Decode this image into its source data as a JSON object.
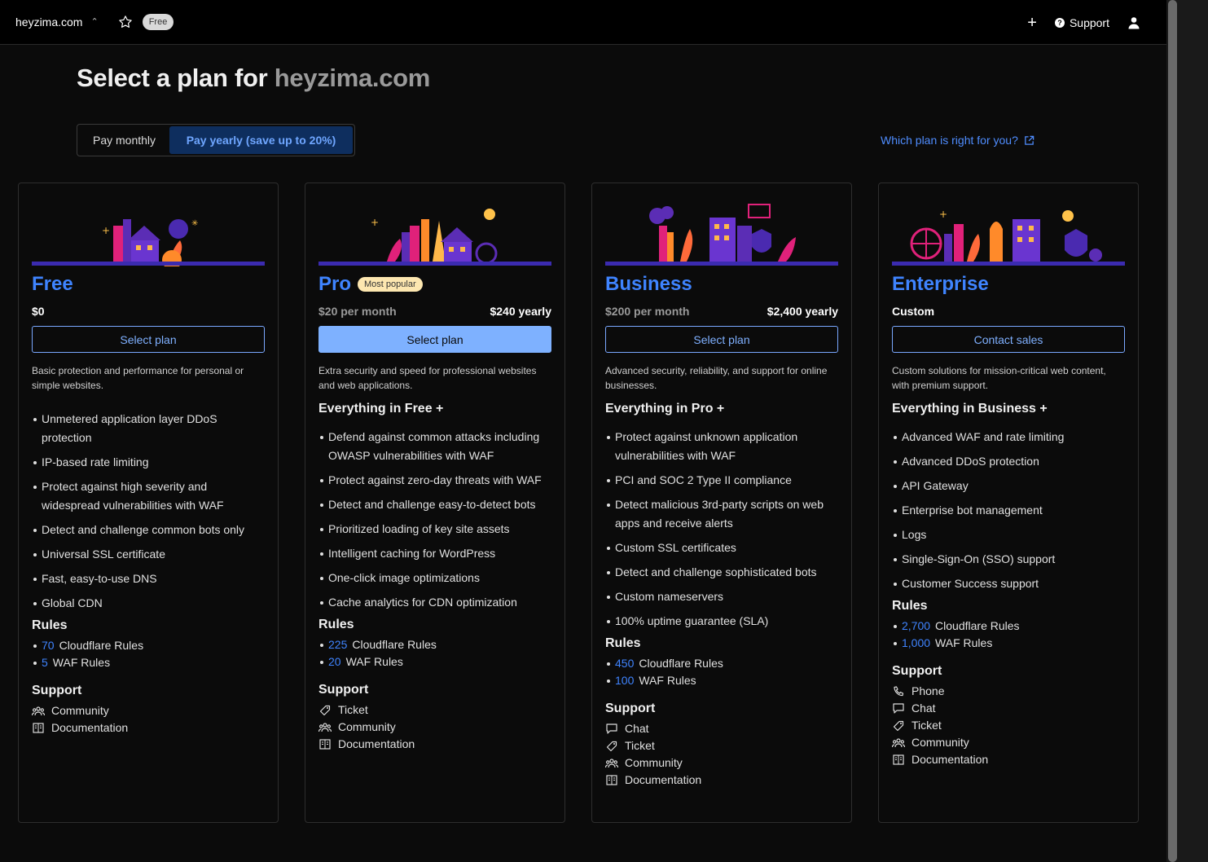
{
  "topbar": {
    "domain": "heyzima.com",
    "free_badge": "Free",
    "support_label": "Support"
  },
  "page": {
    "title_prefix": "Select a plan for ",
    "title_domain": "heyzima.com",
    "toggle": {
      "monthly": "Pay monthly",
      "yearly": "Pay yearly (save up to 20%)"
    },
    "which_link": "Which plan is right for you?"
  },
  "plans": [
    {
      "name": "Free",
      "badge": "",
      "price_left": "$0",
      "price_right": "",
      "button": "Select plan",
      "description": "Basic protection and performance for personal or simple websites.",
      "everything": "",
      "features": [
        "Unmetered application layer DDoS protection",
        "IP-based rate limiting",
        "Protect against high severity and widespread vulnerabilities with WAF",
        "Detect and challenge common bots only",
        "Universal SSL certificate",
        "Fast, easy-to-use DNS",
        "Global CDN"
      ],
      "rules_title": "Rules",
      "rules": [
        {
          "num": "70",
          "label": "Cloudflare Rules"
        },
        {
          "num": "5",
          "label": "WAF Rules"
        }
      ],
      "support_title": "Support",
      "support": [
        {
          "icon": "community-icon",
          "label": "Community"
        },
        {
          "icon": "documentation-icon",
          "label": "Documentation"
        }
      ]
    },
    {
      "name": "Pro",
      "badge": "Most popular",
      "price_left": "$20 per month",
      "price_right": "$240 yearly",
      "button": "Select plan",
      "description": "Extra security and speed for professional websites and web applications.",
      "everything": "Everything in Free +",
      "features": [
        "Defend against common attacks including OWASP vulnerabilities with WAF",
        "Protect against zero-day threats with WAF",
        "Detect and challenge easy-to-detect bots",
        "Prioritized loading of key site assets",
        "Intelligent caching for WordPress",
        "One-click image optimizations",
        "Cache analytics for CDN optimization"
      ],
      "rules_title": "Rules",
      "rules": [
        {
          "num": "225",
          "label": "Cloudflare Rules"
        },
        {
          "num": "20",
          "label": "WAF Rules"
        }
      ],
      "support_title": "Support",
      "support": [
        {
          "icon": "ticket-icon",
          "label": "Ticket"
        },
        {
          "icon": "community-icon",
          "label": "Community"
        },
        {
          "icon": "documentation-icon",
          "label": "Documentation"
        }
      ]
    },
    {
      "name": "Business",
      "badge": "",
      "price_left": "$200 per month",
      "price_right": "$2,400 yearly",
      "button": "Select plan",
      "description": "Advanced security, reliability, and support for online businesses.",
      "everything": "Everything in Pro +",
      "features": [
        "Protect against unknown application vulnerabilities with WAF",
        "PCI and SOC 2 Type II compliance",
        "Detect malicious 3rd-party scripts on web apps and receive alerts",
        "Custom SSL certificates",
        "Detect and challenge sophisticated bots",
        "Custom nameservers",
        "100% uptime guarantee (SLA)"
      ],
      "rules_title": "Rules",
      "rules": [
        {
          "num": "450",
          "label": "Cloudflare Rules"
        },
        {
          "num": "100",
          "label": "WAF Rules"
        }
      ],
      "support_title": "Support",
      "support": [
        {
          "icon": "chat-icon",
          "label": "Chat"
        },
        {
          "icon": "ticket-icon",
          "label": "Ticket"
        },
        {
          "icon": "community-icon",
          "label": "Community"
        },
        {
          "icon": "documentation-icon",
          "label": "Documentation"
        }
      ]
    },
    {
      "name": "Enterprise",
      "badge": "",
      "price_left": "Custom",
      "price_right": "",
      "button": "Contact sales",
      "description": "Custom solutions for mission-critical web content, with premium support.",
      "everything": "Everything in Business +",
      "features": [
        "Advanced WAF and rate limiting",
        "Advanced DDoS protection",
        "API Gateway",
        "Enterprise bot management",
        "Logs",
        "Single-Sign-On (SSO) support",
        "Customer Success support"
      ],
      "rules_title": "Rules",
      "rules": [
        {
          "num": "2,700",
          "label": "Cloudflare Rules"
        },
        {
          "num": "1,000",
          "label": "WAF Rules"
        }
      ],
      "support_title": "Support",
      "support": [
        {
          "icon": "phone-icon",
          "label": "Phone"
        },
        {
          "icon": "chat-icon",
          "label": "Chat"
        },
        {
          "icon": "ticket-icon",
          "label": "Ticket"
        },
        {
          "icon": "community-icon",
          "label": "Community"
        },
        {
          "icon": "documentation-icon",
          "label": "Documentation"
        }
      ]
    }
  ],
  "colors": {
    "accent": "#3f84ff",
    "illustration_bar": "#3b2bb0",
    "popular_badge": "#fde7b0",
    "solid_button": "#7eb1ff"
  }
}
